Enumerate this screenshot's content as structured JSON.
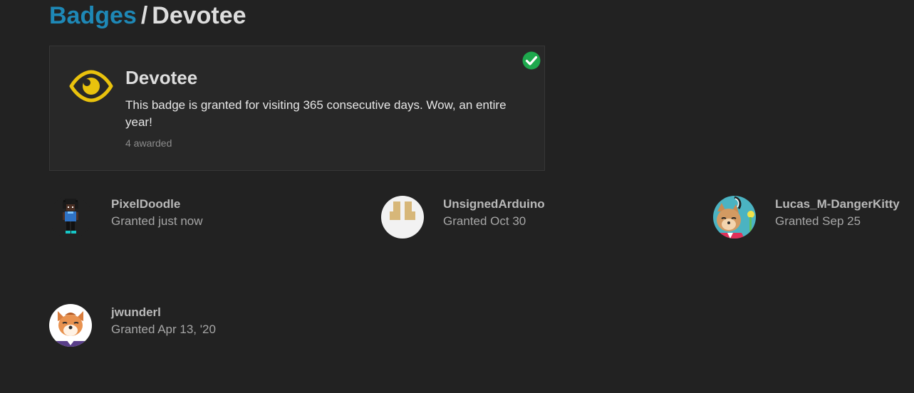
{
  "breadcrumb": {
    "parent": "Badges",
    "separator": "/",
    "current": "Devotee"
  },
  "badge": {
    "title": "Devotee",
    "description": "This badge is granted for visiting 365 consecutive days. Wow, an entire year!",
    "awarded_count": "4 awarded",
    "icon": "eye-icon",
    "icon_color": "#e9c20d",
    "granted_status_icon": "check-circle-icon",
    "granted_color": "#1ea84d"
  },
  "colors": {
    "background": "#222222",
    "link": "#1e88b6",
    "card": "#282828"
  },
  "grants": [
    {
      "user": "PixelDoodle",
      "date": "Granted just now",
      "avatar": "pixel-character-avatar"
    },
    {
      "user": "UnsignedArduino",
      "date": "Granted Oct 30",
      "avatar": "letter-avatar"
    },
    {
      "user": "Lucas_M-DangerKitty",
      "date": "Granted Sep 25",
      "avatar": "cat-avatar"
    },
    {
      "user": "jwunderl",
      "date": "Granted Apr 13, '20",
      "avatar": "fox-avatar"
    }
  ]
}
